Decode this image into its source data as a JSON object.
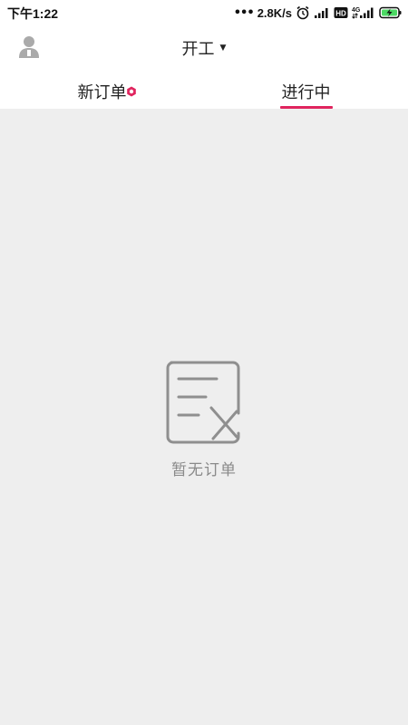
{
  "status_bar": {
    "time": "下午1:22",
    "dots": "•••",
    "net_speed": "2.8K/s",
    "icons": [
      "alarm-icon",
      "signal-icon",
      "hd-icon",
      "4g-signal-icon",
      "battery-charging-icon"
    ],
    "hd_label": "HD",
    "net_type_label": "4G"
  },
  "header": {
    "avatar_icon": "user-avatar-icon",
    "title": "开工",
    "title_caret": "▼"
  },
  "tabs": [
    {
      "label": "新订单",
      "has_badge": true,
      "selected": false
    },
    {
      "label": "进行中",
      "has_badge": false,
      "selected": true
    }
  ],
  "empty_state": {
    "icon": "empty-orders-icon",
    "message": "暂无订单"
  },
  "colors": {
    "accent": "#e0245e",
    "background": "#eeeeee",
    "header_bg": "#ffffff",
    "empty_text": "#8a8a8a",
    "empty_icon": "#8f8f8f"
  }
}
